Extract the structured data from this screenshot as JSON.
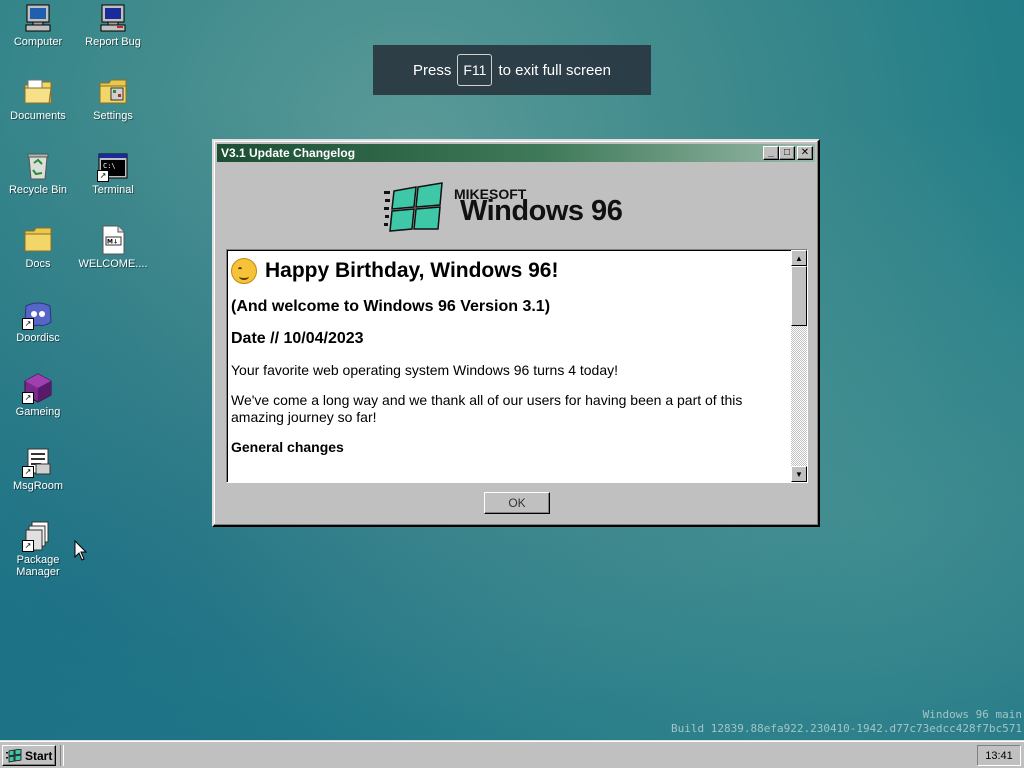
{
  "desktop": {
    "icons": [
      {
        "label": "Computer",
        "icon": "computer-icon"
      },
      {
        "label": "Report Bug",
        "icon": "report-bug-icon"
      },
      {
        "label": "Documents",
        "icon": "documents-folder-icon"
      },
      {
        "label": "Settings",
        "icon": "settings-folder-icon"
      },
      {
        "label": "Recycle Bin",
        "icon": "recycle-bin-icon"
      },
      {
        "label": "Terminal",
        "icon": "terminal-icon"
      },
      {
        "label": "Docs",
        "icon": "docs-folder-icon"
      },
      {
        "label": "WELCOME....",
        "icon": "markdown-file-icon"
      },
      {
        "label": "Doordisc",
        "icon": "doordisc-icon"
      },
      {
        "label": "Gameing",
        "icon": "gameing-cube-icon"
      },
      {
        "label": "MsgRoom",
        "icon": "msgroom-icon"
      },
      {
        "label": "Package Manager",
        "icon": "package-manager-icon"
      }
    ]
  },
  "fullscreen_hint": {
    "prefix": "Press",
    "key": "F11",
    "suffix": "to exit full screen"
  },
  "window": {
    "title": "V3.1 Update Changelog",
    "controls": {
      "minimize": "_",
      "maximize": "□",
      "close": "✕"
    },
    "logo": {
      "small": "MIKESOFT",
      "big": "Windows 96"
    },
    "content": {
      "heading": "Happy Birthday, Windows 96!",
      "subheading": "(And welcome to Windows 96 Version 3.1)",
      "date": "Date // 10/04/2023",
      "paragraphs": [
        "Your favorite web operating system Windows 96 turns 4 today!",
        "We've come a long way and we thank all of our users for having been a part of this amazing journey so far!"
      ],
      "section": "General changes"
    },
    "ok_label": "OK"
  },
  "watermark": {
    "line1": "Windows 96 main",
    "line2": "Build 12839.88efa922.230410-1942.d77c73edcc428f7bc571"
  },
  "taskbar": {
    "start_label": "Start",
    "clock": "13:41"
  },
  "colors": {
    "desktop": "#237e88",
    "titlebar_start": "#1c4f34",
    "titlebar_end": "#98b9a8",
    "chrome": "#c0c0c0"
  }
}
